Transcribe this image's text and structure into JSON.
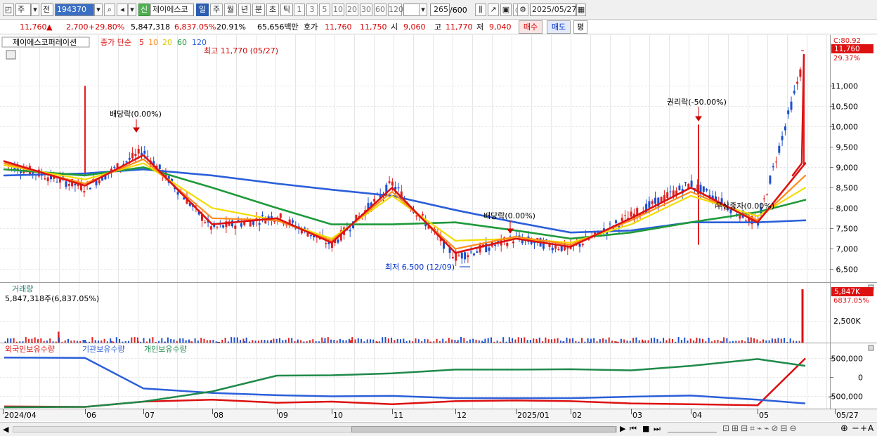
{
  "toolbar": {
    "period_label": "주",
    "all_label": "전",
    "code_value": "194370",
    "name_value": "제이에스코",
    "new_badge": "신",
    "tab_day": "일",
    "tab_week": "주",
    "tab_month": "월",
    "tab_year": "년",
    "tab_minute": "분",
    "tab_second": "초",
    "tab_tick": "틱",
    "intervals": [
      "1",
      "3",
      "5",
      "10",
      "20",
      "30",
      "60",
      "120"
    ],
    "count_value": "265",
    "count_total": "/600",
    "date_value": "2025/05/27"
  },
  "quote": {
    "price": "11,760",
    "change_arrow": "▲",
    "change": "2,700",
    "change_pct": "+29.80%",
    "volume": "5,847,318",
    "volume_pct": "6,837.05%",
    "turnover_pct": "20.91%",
    "amount": "65,656백만",
    "hoga_label": "호가",
    "ask": "11,760",
    "bid": "11,750",
    "open_label": "시",
    "open": "9,060",
    "high_label": "고",
    "high": "11,770",
    "low_label": "저",
    "low": "9,040",
    "buy_label": "매수",
    "sell_label": "매도",
    "eval_label": "평"
  },
  "price_panel": {
    "stock_name": "제이에스코퍼레이션",
    "legend_prefix": "종가 단순",
    "ma_labels": [
      "5",
      "10",
      "20",
      "60",
      "120"
    ],
    "ma_colors": [
      "#dd1111",
      "#ff8c1a",
      "#f0d800",
      "#1f9a3a",
      "#2b5fd9"
    ],
    "current_box": "11,760",
    "right_top": "C:80.92",
    "right_pct": "29.37%",
    "y_ticks": [
      "11,000",
      "10,500",
      "10,000",
      "9,500",
      "9,000",
      "8,500",
      "8,000",
      "7,500",
      "7,000",
      "6,500"
    ],
    "annotations": {
      "high": "최고 11,770 (05/27)",
      "low": "최저 6,500 (12/09)",
      "div1": "배당락(0.00%)",
      "div2": "배당락(0.00%)",
      "rights": "권리락(-50.00%)",
      "bonus": "무상증자(0.00%)"
    }
  },
  "volume_panel": {
    "title": "거래량",
    "summary": "5,847,318주(6,837.05%)",
    "current_box": "5,847K",
    "right_pct": "6837.05%",
    "y_tick": "2,500K"
  },
  "holdings_panel": {
    "legend": [
      "외국인보유수량",
      "기관보유수량",
      "개인보유수량"
    ],
    "legend_colors": [
      "#dd1111",
      "#2b5fd9",
      "#1f8a4a"
    ],
    "y_ticks": [
      "500,000",
      "0",
      "-500,000"
    ]
  },
  "x_axis": {
    "labels": [
      "2024/04",
      "06",
      "07",
      "08",
      "09",
      "10",
      "11",
      "12",
      "2025/01",
      "02",
      "03",
      "04",
      "05",
      "05/27"
    ]
  },
  "chart_data": [
    {
      "type": "line",
      "title": "제이에스코퍼레이션 일봉",
      "ylim": [
        6300,
        11900
      ],
      "x": [
        "2024/04",
        "06",
        "07",
        "08",
        "09",
        "10",
        "11",
        "12",
        "2025/01",
        "02",
        "03",
        "04",
        "05",
        "05/27"
      ],
      "series": [
        {
          "name": "종가",
          "values": [
            9100,
            8500,
            9400,
            7500,
            7800,
            7100,
            8600,
            6800,
            7250,
            7000,
            7800,
            8600,
            7600,
            11760
          ]
        },
        {
          "name": "5",
          "values": [
            9150,
            8550,
            9300,
            7600,
            7750,
            7150,
            8500,
            6900,
            7250,
            7050,
            7750,
            8500,
            7650,
            9100
          ]
        },
        {
          "name": "10",
          "values": [
            9100,
            8600,
            9200,
            7750,
            7700,
            7200,
            8400,
            7000,
            7300,
            7100,
            7700,
            8400,
            7700,
            8800
          ]
        },
        {
          "name": "20",
          "values": [
            9050,
            8700,
            9100,
            8000,
            7700,
            7250,
            8300,
            7200,
            7250,
            7150,
            7600,
            8300,
            7800,
            8500
          ]
        },
        {
          "name": "60",
          "values": [
            8950,
            8800,
            9000,
            8500,
            8000,
            7600,
            7600,
            7650,
            7450,
            7250,
            7400,
            7650,
            7900,
            8200
          ]
        },
        {
          "name": "120",
          "values": [
            8800,
            8850,
            8950,
            8800,
            8600,
            8450,
            8300,
            7950,
            7650,
            7400,
            7450,
            7650,
            7650,
            7700
          ]
        }
      ],
      "high": {
        "value": 11770,
        "date": "05/27"
      },
      "low": {
        "value": 6500,
        "date": "12/09"
      }
    },
    {
      "type": "bar",
      "title": "거래량",
      "ylim": [
        0,
        6000000
      ],
      "values": [
        120000,
        90000,
        1200000,
        300000,
        180000,
        130000,
        110000,
        140000,
        90000,
        160000,
        280000,
        120000,
        100000,
        260000,
        90000,
        80000,
        100000,
        70000,
        90000,
        80000,
        160000,
        110000,
        90000,
        120000,
        150000,
        100000,
        90000,
        120000,
        80000,
        100000,
        5847318
      ],
      "last_value": 5847318
    },
    {
      "type": "line",
      "title": "보유수량",
      "ylim": [
        -800000,
        600000
      ],
      "x": [
        "2024/04",
        "06",
        "07",
        "08",
        "09",
        "10",
        "11",
        "12",
        "2025/01",
        "02",
        "03",
        "04",
        "05",
        "05/27"
      ],
      "series": [
        {
          "name": "외국인보유수량",
          "values": [
            -780000,
            -790000,
            -650000,
            -600000,
            -680000,
            -650000,
            -720000,
            -640000,
            -620000,
            -640000,
            -700000,
            -720000,
            -750000,
            500000
          ]
        },
        {
          "name": "기관보유수량",
          "values": [
            520000,
            510000,
            -300000,
            -420000,
            -480000,
            -510000,
            -500000,
            -560000,
            -560000,
            -560000,
            -520000,
            -490000,
            -600000,
            -700000
          ]
        },
        {
          "name": "개인보유수량",
          "values": [
            -800000,
            -790000,
            -650000,
            -380000,
            40000,
            50000,
            100000,
            200000,
            200000,
            210000,
            180000,
            300000,
            480000,
            300000
          ]
        }
      ]
    }
  ]
}
